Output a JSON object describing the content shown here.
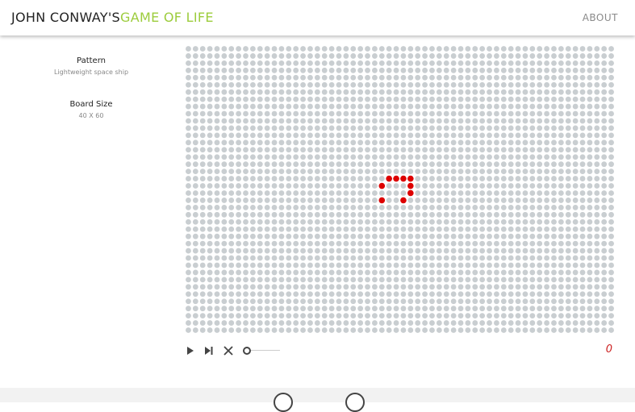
{
  "header": {
    "title_part1": "JOHN CONWAY'S",
    "title_part2": "GAME OF LIFE",
    "about_label": "ABOUT"
  },
  "sidebar": {
    "pattern_label": "Pattern",
    "pattern_value": "Lightweight space ship",
    "board_size_label": "Board Size",
    "board_size_value": "40 X 60"
  },
  "board": {
    "rows": 40,
    "cols": 60,
    "live_color": "#dd0000",
    "dead_color": "#c9ced1",
    "live_cells": [
      [
        18,
        28
      ],
      [
        18,
        29
      ],
      [
        18,
        30
      ],
      [
        18,
        31
      ],
      [
        19,
        27
      ],
      [
        19,
        31
      ],
      [
        20,
        31
      ],
      [
        21,
        27
      ],
      [
        21,
        30
      ]
    ]
  },
  "controls": {
    "icons": [
      "play-icon",
      "step-icon",
      "clear-icon"
    ],
    "speed": 0
  },
  "generation": "0",
  "footer": {
    "icons": [
      "github-icon",
      "mail-icon"
    ]
  }
}
